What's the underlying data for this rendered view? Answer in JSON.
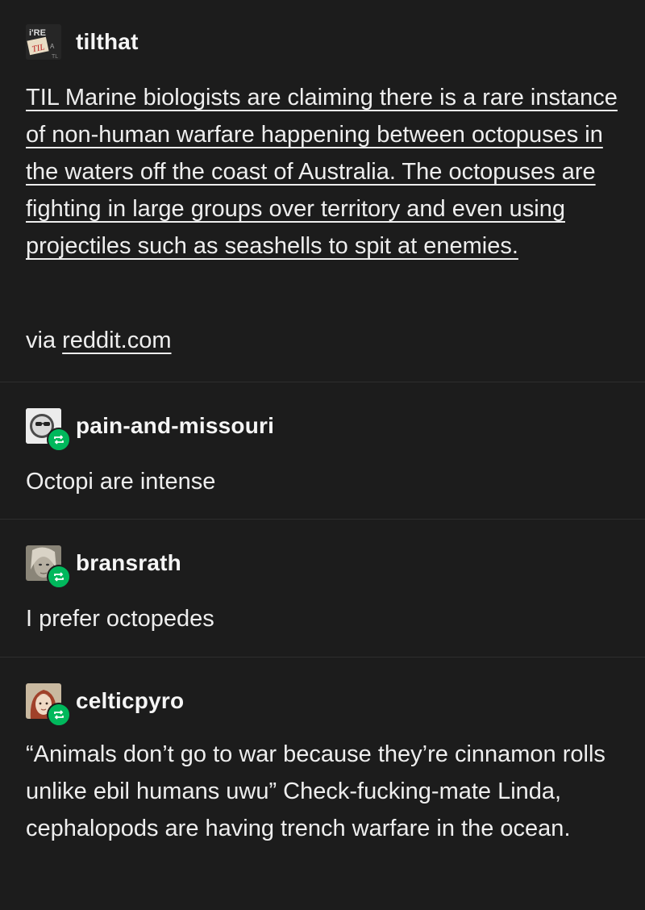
{
  "posts": [
    {
      "username": "tilthat",
      "avatar": "til-logo-avatar",
      "reblog": false,
      "text": "TIL Marine biologists are claiming there is a rare instance of non-human warfare happening between octopuses in the waters off the coast of Australia. The octopuses are fighting in large groups over territory and even using projectiles such as seashells to spit at enemies.",
      "via_prefix": "via",
      "via_link": "reddit.com"
    },
    {
      "username": "pain-and-missouri",
      "avatar": "sunglasses-avatar",
      "reblog": true,
      "text": "Octopi are intense"
    },
    {
      "username": "bransrath",
      "avatar": "portrait-avatar",
      "reblog": true,
      "text": "I prefer octopedes"
    },
    {
      "username": "celticpyro",
      "avatar": "redhead-avatar",
      "reblog": true,
      "text": "“Animals don’t go to war because they’re cinnamon rolls unlike ebil humans uwu” Check-fucking-mate Linda, cephalopods are having trench warfare in the ocean."
    }
  ],
  "colors": {
    "background": "#1c1c1c",
    "reblog_badge": "#00b85c",
    "text": "#eeeeee"
  },
  "icons": [
    "reblog-icon"
  ]
}
